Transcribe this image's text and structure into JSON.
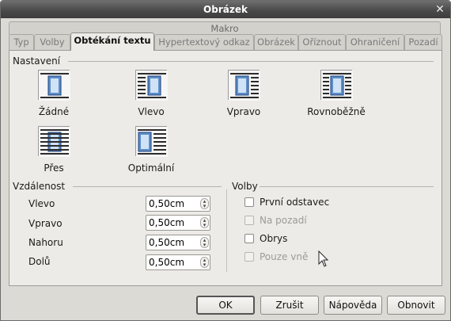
{
  "window": {
    "title": "Obrázek"
  },
  "tabs_top": [
    "Makro"
  ],
  "tabs": [
    "Typ",
    "Volby",
    "Obtékání textu",
    "Hypertextový odkaz",
    "Obrázek",
    "Oříznout",
    "Ohraničení",
    "Pozadí"
  ],
  "active_tab": "Obtékání textu",
  "settings": {
    "title": "Nastavení",
    "options": [
      "Žádné",
      "Vlevo",
      "Vpravo",
      "Rovnoběžně",
      "Přes",
      "Optimální"
    ]
  },
  "spacing": {
    "title": "Vzdálenost",
    "fields": [
      {
        "label": "Vlevo",
        "value": "0,50cm"
      },
      {
        "label": "Vpravo",
        "value": "0,50cm"
      },
      {
        "label": "Nahoru",
        "value": "0,50cm"
      },
      {
        "label": "Dolů",
        "value": "0,50cm"
      }
    ]
  },
  "options": {
    "title": "Volby",
    "checkboxes": [
      {
        "label": "První odstavec",
        "checked": false,
        "enabled": true
      },
      {
        "label": "Na pozadí",
        "checked": false,
        "enabled": false
      },
      {
        "label": "Obrys",
        "checked": false,
        "enabled": true
      },
      {
        "label": "Pouze vně",
        "checked": false,
        "enabled": false
      }
    ]
  },
  "buttons": {
    "ok": "OK",
    "cancel": "Zrušit",
    "help": "Nápověda",
    "reset": "Obnovit"
  }
}
